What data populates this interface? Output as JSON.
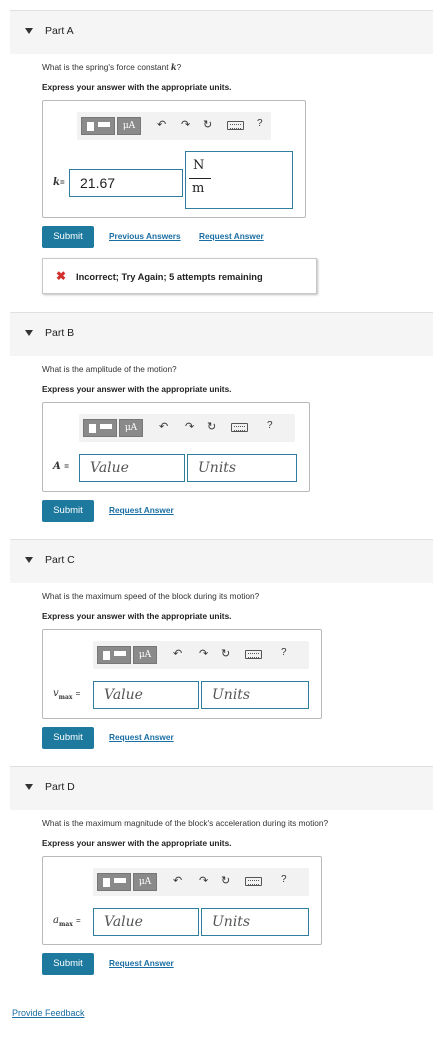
{
  "parts": {
    "a": {
      "title": "Part A",
      "question_prefix": "What is the spring's force constant ",
      "question_var": "k",
      "question_suffix": "?",
      "express": "Express your answer with the appropriate units.",
      "var_label": "k",
      "var_eq": "=",
      "value": "21.67",
      "unit_numerator": "N",
      "unit_denominator": "m",
      "submit": "Submit",
      "previous_answers": "Previous Answers",
      "request_answer": "Request Answer",
      "feedback": "Incorrect; Try Again; 5 attempts remaining"
    },
    "b": {
      "title": "Part B",
      "question": "What is the amplitude of the motion?",
      "express": "Express your answer with the appropriate units.",
      "var_label": "A",
      "var_eq": "=",
      "value_placeholder": "Value",
      "units_placeholder": "Units",
      "submit": "Submit",
      "request_answer": "Request Answer"
    },
    "c": {
      "title": "Part C",
      "question": "What is the maximum speed of the block during its motion?",
      "express": "Express your answer with the appropriate units.",
      "var_label": "v",
      "var_sub": "max",
      "var_eq": "=",
      "value_placeholder": "Value",
      "units_placeholder": "Units",
      "submit": "Submit",
      "request_answer": "Request Answer"
    },
    "d": {
      "title": "Part D",
      "question": "What is the maximum magnitude of the block's acceleration during its motion?",
      "express": "Express your answer with the appropriate units.",
      "var_label": "a",
      "var_sub": "max",
      "var_eq": "=",
      "value_placeholder": "Value",
      "units_placeholder": "Units",
      "submit": "Submit",
      "request_answer": "Request Answer"
    }
  },
  "toolbar": {
    "mu_label": "μA",
    "undo": "↶",
    "redo": "↷",
    "reset": "↻",
    "help": "?"
  },
  "footer": {
    "provide_feedback": "Provide Feedback"
  },
  "colors": {
    "accent": "#1d7a9e",
    "link": "#1a6ea3",
    "error": "#d0312d",
    "header_bg": "#f5f5f5"
  }
}
